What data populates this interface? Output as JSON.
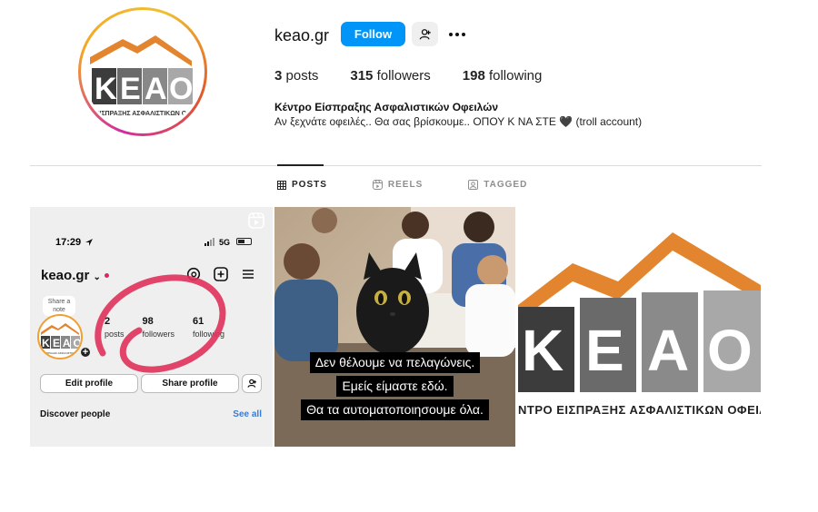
{
  "profile": {
    "username": "keao.gr",
    "follow_label": "Follow",
    "stats": {
      "posts_count": "3",
      "posts_label": "posts",
      "followers_count": "315",
      "followers_label": "followers",
      "following_count": "198",
      "following_label": "following"
    },
    "full_name": "Κέντρο Είσπραξης Ασφαλιστικών Οφειλών",
    "bio": "Αν ξεχνάτε οφειλές.. Θα σας βρίσκουμε.. ΟΠΟΥ Κ ΝΑ ΣΤΕ 🖤 (troll account)"
  },
  "logo": {
    "letters": "KEAO",
    "subtitle": "ΕΙΣΠΡΑΞΗΣ ΑΣΦΑΛΙΣΤΙΚΩΝ Ο"
  },
  "tabs": [
    {
      "label": "POSTS",
      "icon": "grid-icon",
      "active": true
    },
    {
      "label": "REELS",
      "icon": "reels-icon",
      "active": false
    },
    {
      "label": "TAGGED",
      "icon": "tagged-icon",
      "active": false
    }
  ],
  "posts": {
    "post1": {
      "time": "17:29",
      "network": "5G",
      "username": "keao.gr",
      "note": "Share a note",
      "avatar_subtitle": "ΕΙΣΠΡΑΞΗΣ ΑΣΦΑΛΙΣΤΙΚΩΝ",
      "posts_count": "2",
      "posts_label": "posts",
      "followers_count": "98",
      "followers_label": "followers",
      "following_count": "61",
      "following_label": "following",
      "edit_label": "Edit profile",
      "share_label": "Share profile",
      "discover_label": "Discover people",
      "see_all_label": "See all"
    },
    "post2": {
      "caption_lines": [
        "Δεν θέλουμε να πελαγώνεις.",
        "Εμείς είμαστε εδώ.",
        "Θα τα αυτοματοποιησουμε όλα."
      ]
    },
    "post3": {
      "letters": "KEAO",
      "text": "ΝΤΡΟ ΕΙΣΠΡΑΞΗΣ ΑΣΦΑΛΙΣΤΙΚΩΝ ΟΦΕΙΛ"
    }
  },
  "colors": {
    "follow_blue": "#0095f6",
    "logo_orange": "#e2852e",
    "logo_grey": "#5a5a5a",
    "scribble_red": "#e0305a"
  }
}
